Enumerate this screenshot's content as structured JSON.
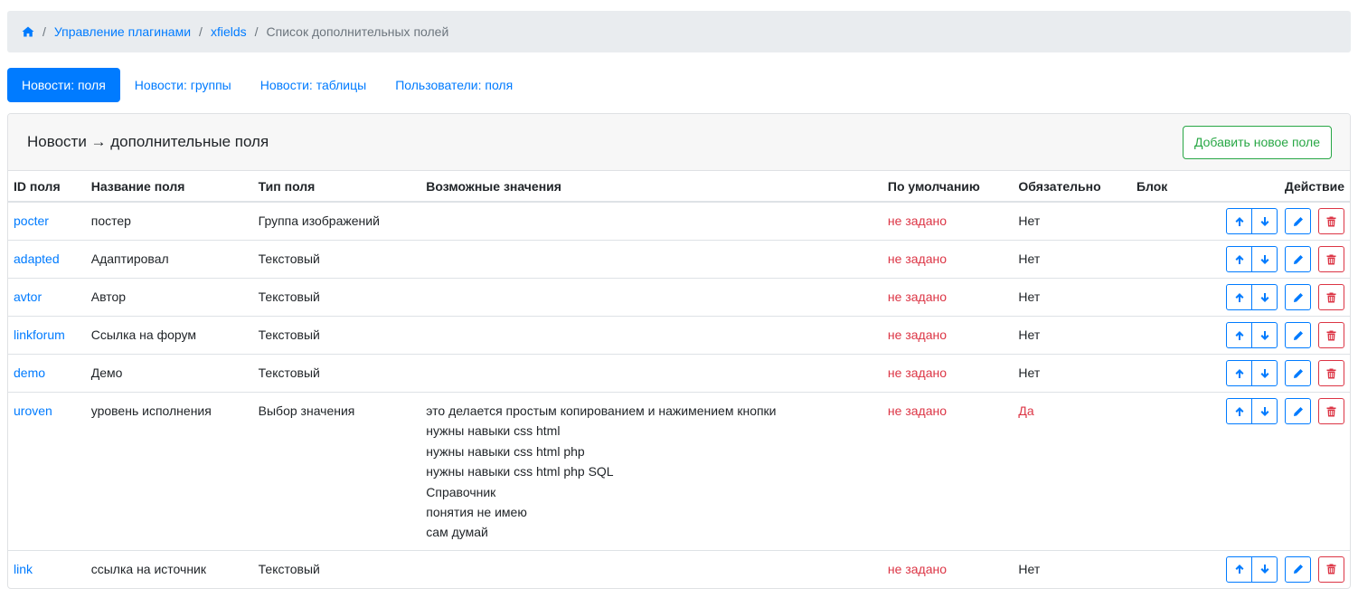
{
  "breadcrumb": {
    "home_icon": "home-icon",
    "items": [
      {
        "label": "Управление плагинами"
      },
      {
        "label": "xfields"
      },
      {
        "label": "Список дополнительных полей"
      }
    ],
    "separator": "/"
  },
  "tabs": [
    {
      "label": "Новости: поля",
      "active": true
    },
    {
      "label": "Новости: группы"
    },
    {
      "label": "Новости: таблицы"
    },
    {
      "label": "Пользователи: поля"
    }
  ],
  "card": {
    "title": "Новости → дополнительные поля",
    "add_button": "Добавить новое поле"
  },
  "table": {
    "headers": [
      "ID поля",
      "Название поля",
      "Тип поля",
      "Возможные значения",
      "По умолчанию",
      "Обязательно",
      "Блок",
      "Действие"
    ],
    "rows": [
      {
        "id": "pocter",
        "name": "постер",
        "type": "Группа изображений",
        "default": "не задано",
        "required": "Нет"
      },
      {
        "id": "adapted",
        "name": "Адаптировал",
        "type": "Текстовый",
        "default": "не задано",
        "required": "Нет"
      },
      {
        "id": "avtor",
        "name": "Автор",
        "type": "Текстовый",
        "default": "не задано",
        "required": "Нет"
      },
      {
        "id": "linkforum",
        "name": "Ссылка на форум",
        "type": "Текстовый",
        "default": "не задано",
        "required": "Нет"
      },
      {
        "id": "demo",
        "name": "Демо",
        "type": "Текстовый",
        "default": "не задано",
        "required": "Нет"
      },
      {
        "id": "uroven",
        "name": "уровень исполнения",
        "type": "Выбор значения",
        "values": [
          "это делается простым копированием и нажимением кнопки",
          "нужны навыки css html",
          "нужны навыки css html php",
          "нужны навыки css html php SQL",
          "Справочник",
          "понятия не имею",
          "сам думай"
        ],
        "default": "не задано",
        "required": "Да"
      },
      {
        "id": "link",
        "name": "ссылка на источник",
        "type": "Текстовый",
        "default": "не задано",
        "required": "Нет"
      }
    ]
  },
  "action_icons": [
    "arrow-up-icon",
    "arrow-down-icon",
    "pencil-icon",
    "trash-icon"
  ],
  "colors": {
    "primary": "#007bff",
    "success": "#28a745",
    "danger": "#dc3545",
    "muted": "#6c757d",
    "breadcrumb_bg": "#e9ecef"
  }
}
